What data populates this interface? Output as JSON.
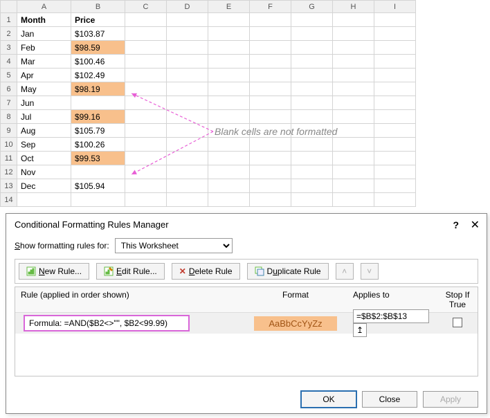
{
  "columns": [
    "A",
    "B",
    "C",
    "D",
    "E",
    "F",
    "G",
    "H",
    "I"
  ],
  "rows": [
    "1",
    "2",
    "3",
    "4",
    "5",
    "6",
    "7",
    "8",
    "9",
    "10",
    "11",
    "12",
    "13",
    "14"
  ],
  "headers": {
    "A": "Month",
    "B": "Price"
  },
  "data": [
    {
      "month": "Jan",
      "price": "$103.87",
      "hl": false
    },
    {
      "month": "Feb",
      "price": "$98.59",
      "hl": true
    },
    {
      "month": "Mar",
      "price": "$100.46",
      "hl": false
    },
    {
      "month": "Apr",
      "price": "$102.49",
      "hl": false
    },
    {
      "month": "May",
      "price": "$98.19",
      "hl": true
    },
    {
      "month": "Jun",
      "price": "",
      "hl": false
    },
    {
      "month": "Jul",
      "price": "$99.16",
      "hl": true
    },
    {
      "month": "Aug",
      "price": "$105.79",
      "hl": false
    },
    {
      "month": "Sep",
      "price": "$100.26",
      "hl": false
    },
    {
      "month": "Oct",
      "price": "$99.53",
      "hl": true
    },
    {
      "month": "Nov",
      "price": "",
      "hl": false
    },
    {
      "month": "Dec",
      "price": "$105.94",
      "hl": false
    }
  ],
  "annotation": "Blank cells are not formatted",
  "dialog": {
    "title": "Conditional Formatting Rules Manager",
    "show_label_pre": "S",
    "show_label_post": "how formatting rules for:",
    "select_value": "This Worksheet",
    "buttons": {
      "new": "ew Rule...",
      "new_u": "N",
      "edit": "dit Rule...",
      "edit_u": "E",
      "delete": "elete Rule",
      "delete_u": "D",
      "dup": "plicate Rule",
      "dup_u": "u",
      "dup_pre": "D"
    },
    "grid_headers": {
      "rule": "Rule (applied in order shown)",
      "format": "Format",
      "applies": "Applies to",
      "stop": "Stop If True"
    },
    "rule": {
      "formula": "Formula: =AND($B2<>\"\", $B2<99.99)",
      "sample": "AaBbCcYyZz",
      "applies_to": "=$B$2:$B$13"
    },
    "footer": {
      "ok": "OK",
      "close": "Close",
      "apply": "Apply"
    }
  }
}
